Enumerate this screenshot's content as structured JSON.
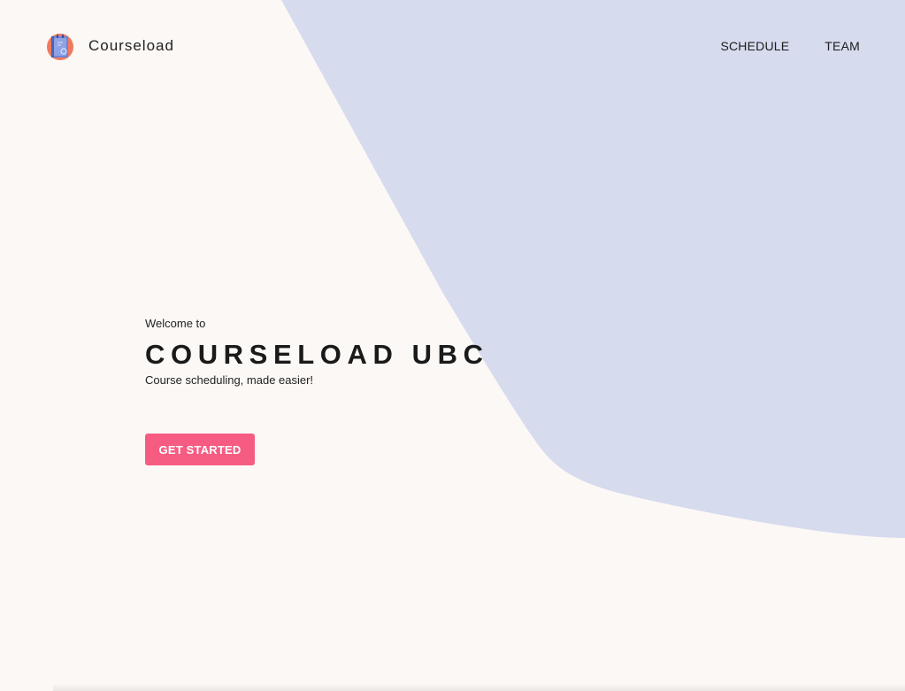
{
  "brand": {
    "name": "Courseload",
    "logo_icon": "notebook-icon"
  },
  "nav": {
    "items": [
      {
        "label": "SCHEDULE"
      },
      {
        "label": "TEAM"
      }
    ]
  },
  "hero": {
    "kicker": "Welcome to",
    "title": "COURSELOAD UBC",
    "tagline": "Course scheduling, made easier!",
    "cta_label": "GET STARTED"
  },
  "colors": {
    "background": "#fcf8f5",
    "blob": "#d6dbee",
    "accent": "#f65c82",
    "text": "#1e1e1e"
  }
}
